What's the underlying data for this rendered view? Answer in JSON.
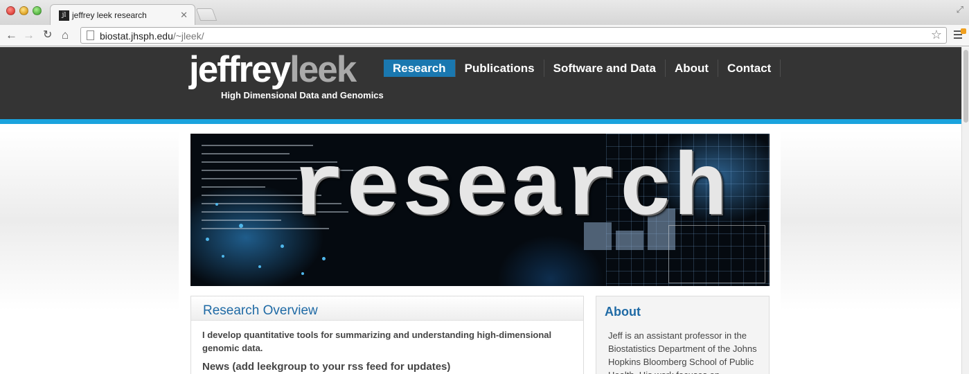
{
  "browser": {
    "tab_title": "jeffrey leek research",
    "tab_favicon": "jl",
    "close_glyph": "✕",
    "url_host": "biostat.jhsph.edu",
    "url_path": "/~jleek/",
    "icons": [
      "back-icon",
      "forward-icon",
      "reload-icon",
      "home-icon",
      "page-icon",
      "star-icon",
      "menu-icon"
    ]
  },
  "site": {
    "logo_first": "jeffrey",
    "logo_last": "leek",
    "tagline": "High Dimensional Data and Genomics",
    "nav": [
      {
        "label": "Research",
        "active": true
      },
      {
        "label": "Publications",
        "active": false
      },
      {
        "label": "Software and Data",
        "active": false
      },
      {
        "label": "About",
        "active": false
      },
      {
        "label": "Contact",
        "active": false
      }
    ],
    "banner_word": "research",
    "main": {
      "title": "Research Overview",
      "overview": "I develop quantitative tools for summarizing and understanding high-dimensional genomic data.",
      "news_title": "News (add leekgroup to your rss feed for updates)"
    },
    "side": {
      "title": "About",
      "text": "Jeff is an assistant professor in the Biostatistics Department of the Johns Hopkins Bloomberg School of Public Health. His work focuses on"
    }
  },
  "colors": {
    "header_bg": "#343434",
    "accent_blue": "#1aa3dd",
    "nav_active": "#1a78b0",
    "heading_blue": "#1f6aa5"
  }
}
